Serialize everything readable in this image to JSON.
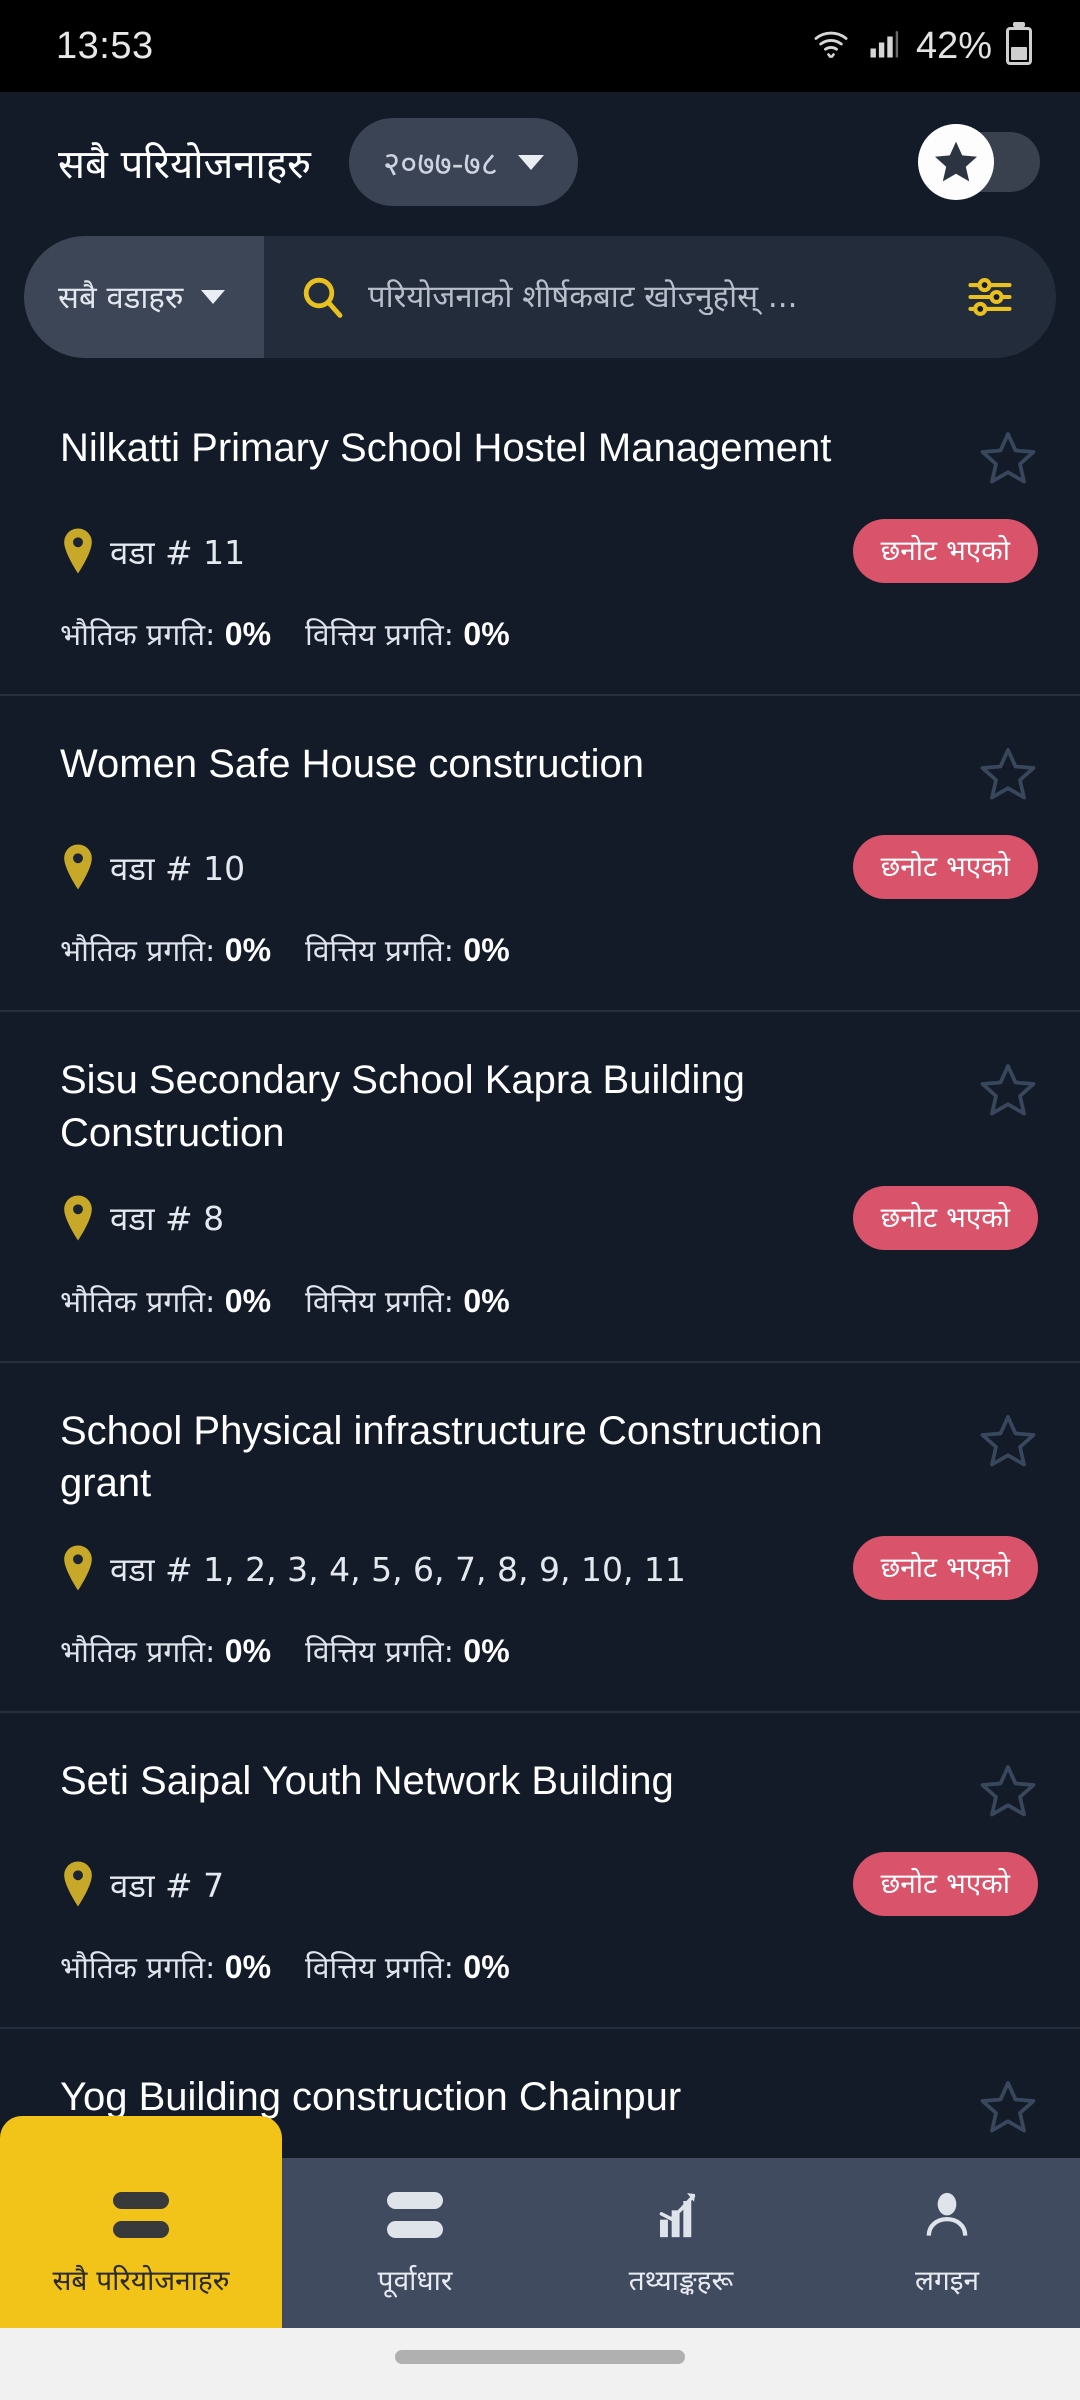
{
  "status_bar": {
    "time": "13:53",
    "battery_percent": "42%",
    "icons": [
      "wifi-icon",
      "cellular-signal-icon",
      "battery-icon"
    ]
  },
  "header": {
    "title": "सबै परियोजनाहरु",
    "year": "२०७७-७८",
    "year_caret_icon": "chevron-down-icon",
    "favorite_toggle": {
      "icon": "star-icon",
      "state": "off"
    }
  },
  "search": {
    "ward_filter_label": "सबै वडाहरु",
    "ward_caret_icon": "chevron-down-icon",
    "search_icon": "search-icon",
    "placeholder": "परियोजनाको शीर्षकबाट खोज्नुहोस् ...",
    "value": "",
    "filter_icon": "tune-filter-icon",
    "accent_color": "#e8c020"
  },
  "labels": {
    "physical_progress": "भौतिक प्रगति:",
    "financial_progress": "वित्तिय प्रगति:",
    "ward_prefix": "वडा #",
    "pin_icon": "location-pin-icon",
    "favorite_icon": "star-outline-icon",
    "badge_color": "#d9536a"
  },
  "projects": [
    {
      "title": "Nilkatti Primary School Hostel Management",
      "ward": "वडा # 11",
      "badge": "छनोट भएको",
      "physical_progress": "0%",
      "financial_progress": "0%"
    },
    {
      "title": "Women Safe House construction",
      "ward": "वडा # 10",
      "badge": "छनोट भएको",
      "physical_progress": "0%",
      "financial_progress": "0%"
    },
    {
      "title": "Sisu Secondary School Kapra Building Construction",
      "ward": "वडा # 8",
      "badge": "छनोट भएको",
      "physical_progress": "0%",
      "financial_progress": "0%"
    },
    {
      "title": "School Physical infrastructure Construction grant",
      "ward": "वडा # 1, 2, 3, 4, 5, 6, 7, 8, 9, 10, 11",
      "badge": "छनोट भएको",
      "physical_progress": "0%",
      "financial_progress": "0%"
    },
    {
      "title": "Seti Saipal Youth Network Building",
      "ward": "वडा # 7",
      "badge": "छनोट भएको",
      "physical_progress": "0%",
      "financial_progress": "0%"
    },
    {
      "title": "Yog Building construction Chainpur",
      "ward": "",
      "badge": "",
      "physical_progress": "",
      "financial_progress": ""
    }
  ],
  "bottom_nav": {
    "active_color": "#f2c319",
    "items": [
      {
        "label": "सबै परियोजनाहरु",
        "icon": "list-bars-icon",
        "active": true
      },
      {
        "label": "पूर्वाधार",
        "icon": "list-bars-icon",
        "active": false
      },
      {
        "label": "तथ्याङ्कहरू",
        "icon": "bar-chart-icon",
        "active": false
      },
      {
        "label": "लगइन",
        "icon": "person-icon",
        "active": false
      }
    ]
  }
}
